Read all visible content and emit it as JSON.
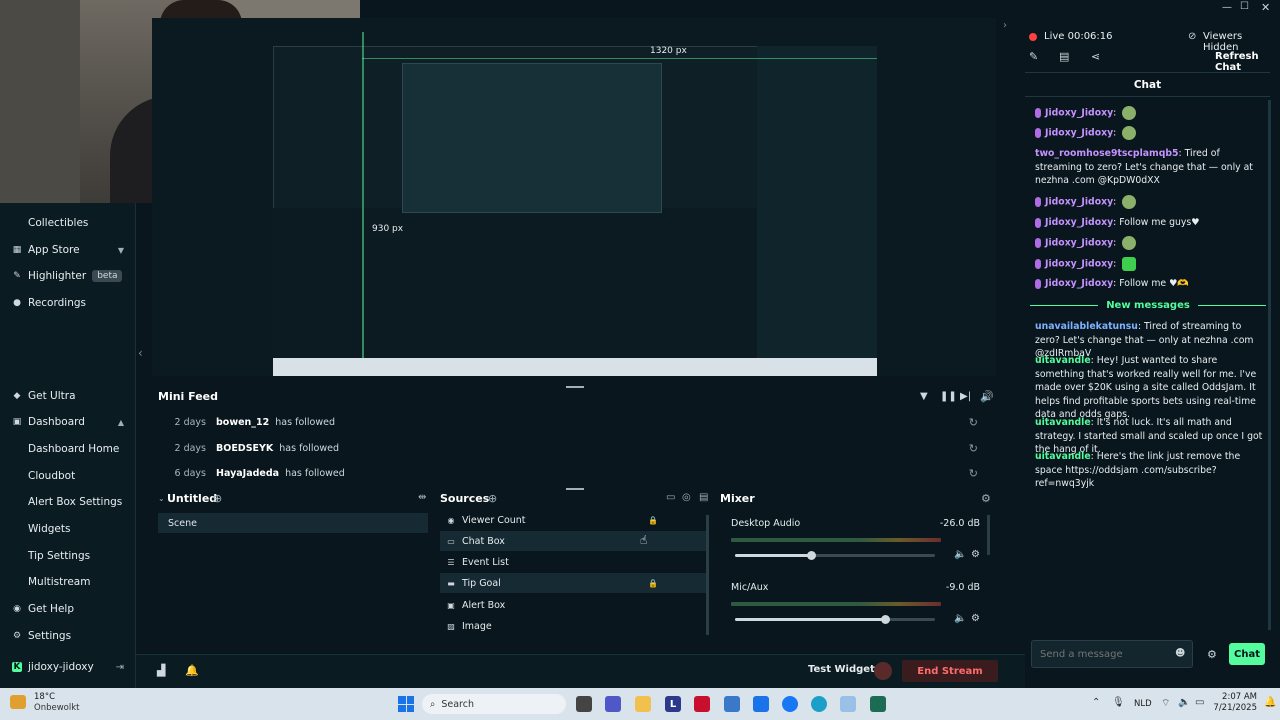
{
  "sidebar": {
    "items": [
      {
        "label": "Collectibles",
        "icon": "none",
        "sub": false
      },
      {
        "label": "App Store",
        "icon": "grid-icon",
        "sub": false
      },
      {
        "label": "Highlighter",
        "icon": "highlighter-icon",
        "sub": false,
        "badge": "beta"
      },
      {
        "label": "Recordings",
        "icon": "record-icon",
        "sub": false
      },
      {
        "label": "Get Ultra",
        "icon": "ultra-icon",
        "sub": false
      },
      {
        "label": "Dashboard",
        "icon": "dashboard-icon",
        "sub": false
      },
      {
        "label": "Dashboard Home",
        "icon": "none",
        "sub": true
      },
      {
        "label": "Cloudbot",
        "icon": "none",
        "sub": true
      },
      {
        "label": "Alert Box Settings",
        "icon": "none",
        "sub": true
      },
      {
        "label": "Widgets",
        "icon": "none",
        "sub": true
      },
      {
        "label": "Tip Settings",
        "icon": "none",
        "sub": true
      },
      {
        "label": "Multistream",
        "icon": "none",
        "sub": true
      },
      {
        "label": "Get Help",
        "icon": "help-icon",
        "sub": false
      },
      {
        "label": "Settings",
        "icon": "gear-icon",
        "sub": false
      }
    ],
    "user": "jidoxy-jidoxy"
  },
  "preview": {
    "width_label": "1320 px",
    "height_label": "930 px"
  },
  "minifeed": {
    "title": "Mini Feed",
    "rows": [
      {
        "time": "2 days",
        "user": "bowen_12",
        "action": "has followed"
      },
      {
        "time": "2 days",
        "user": "BOEDSEYK",
        "action": "has followed"
      },
      {
        "time": "6 days",
        "user": "HayaJadeda",
        "action": "has followed"
      }
    ]
  },
  "scenes": {
    "title": "Untitled",
    "items": [
      "Scene"
    ]
  },
  "sources": {
    "title": "Sources",
    "items": [
      {
        "label": "Viewer Count",
        "locked": true,
        "selected": false
      },
      {
        "label": "Chat Box",
        "locked": false,
        "selected": true
      },
      {
        "label": "Event List",
        "locked": false,
        "selected": false
      },
      {
        "label": "Tip Goal",
        "locked": true,
        "selected": true
      },
      {
        "label": "Alert Box",
        "locked": false,
        "selected": false
      },
      {
        "label": "Image",
        "locked": false,
        "selected": false
      }
    ]
  },
  "mixer": {
    "title": "Mixer",
    "channels": [
      {
        "name": "Desktop Audio",
        "db": "-26.0 dB",
        "level": 0.38
      },
      {
        "name": "Mic/Aux",
        "db": "-9.0 dB",
        "level": 0.75
      }
    ]
  },
  "footer": {
    "test_widgets": "Test Widgets",
    "end_stream": "End Stream"
  },
  "chat": {
    "live_time": "Live 00:06:16",
    "viewers": "Viewers Hidden",
    "refresh": "Refresh Chat",
    "title": "Chat",
    "new_messages": "New messages",
    "input_placeholder": "Send a message",
    "send": "Chat",
    "messages": [
      {
        "user": "Jidoxy_Jidoxy",
        "text": "",
        "color": "pink",
        "mic": true,
        "emote": "round"
      },
      {
        "user": "Jidoxy_Jidoxy",
        "text": "",
        "color": "pink",
        "mic": true,
        "emote": "round"
      },
      {
        "user": "two_roomhose9tscplamqb5",
        "text": "Tired of streaming to zero? Let's change that — only at nezhna .com @KpDW0dXX",
        "color": "pink",
        "mic": false
      },
      {
        "user": "Jidoxy_Jidoxy",
        "text": "",
        "color": "pink",
        "mic": true,
        "emote": "round"
      },
      {
        "user": "Jidoxy_Jidoxy",
        "text": "Follow me guys♥",
        "color": "pink",
        "mic": true
      },
      {
        "user": "Jidoxy_Jidoxy",
        "text": "",
        "color": "pink",
        "mic": true,
        "emote": "round"
      },
      {
        "user": "Jidoxy_Jidoxy",
        "text": "",
        "color": "pink",
        "mic": true,
        "emote": "square"
      },
      {
        "user": "Jidoxy_Jidoxy",
        "text": "Follow me ♥🫶",
        "color": "pink",
        "mic": true
      }
    ],
    "new": [
      {
        "user": "unavailablekatunsu",
        "text": "Tired of streaming to zero? Let's change that — only at nezhna .com @zdIRmbaV",
        "color": "blue"
      },
      {
        "user": "uitavandle",
        "text": "Hey! Just wanted to share something that's worked really well for me. I've made over $20K using a site called OddsJam. It helps find profitable sports bets using real-time data and odds gaps.",
        "color": "green"
      },
      {
        "user": "uitavandle",
        "text": "It's not luck. It's all math and strategy. I started small and scaled up once I got the hang of it.",
        "color": "green"
      },
      {
        "user": "uitavandle",
        "text": "Here's the link just remove the space https://oddsjam .com/subscribe?ref=nwq3yjk",
        "color": "green"
      }
    ]
  },
  "taskbar": {
    "weather_temp": "18°C",
    "weather_desc": "Onbewolkt",
    "search": "Search",
    "lang": "NLD",
    "time": "2:07 AM",
    "date": "7/21/2025"
  }
}
